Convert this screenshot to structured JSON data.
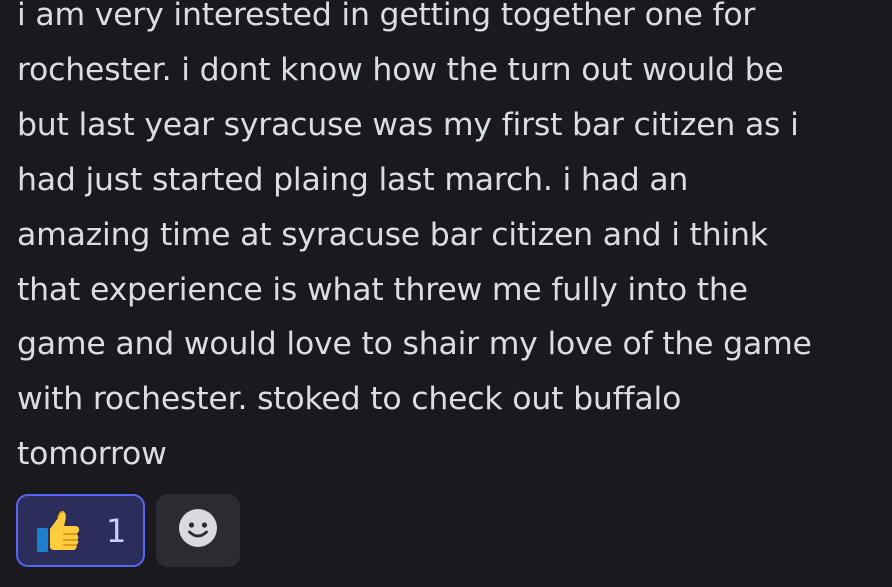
{
  "message": {
    "lines": [
      "i am very interested in getting together one for",
      "rochester. i dont know how the turn out would be",
      "but last year syracuse was my first bar citizen as i",
      "had just started plaing last march. i had an",
      "amazing time at syracuse bar citizen and i think",
      "that experience is what threw me fully into the",
      "game and would love to shair my love of the game",
      "with rochester. stoked to check out buffalo",
      "tomorrow"
    ]
  },
  "reactions": [
    {
      "icon": "thumbs-up-icon",
      "count": "1"
    }
  ],
  "add_reaction": {
    "icon": "smiley-icon"
  },
  "colors": {
    "background": "#1a1a1e",
    "text": "#dbdee1",
    "reaction_border": "#5865f2",
    "reaction_bg": "#2b2d5a",
    "reaction_count": "#c9cdfb",
    "add_reaction_bg": "#2b2c31"
  }
}
